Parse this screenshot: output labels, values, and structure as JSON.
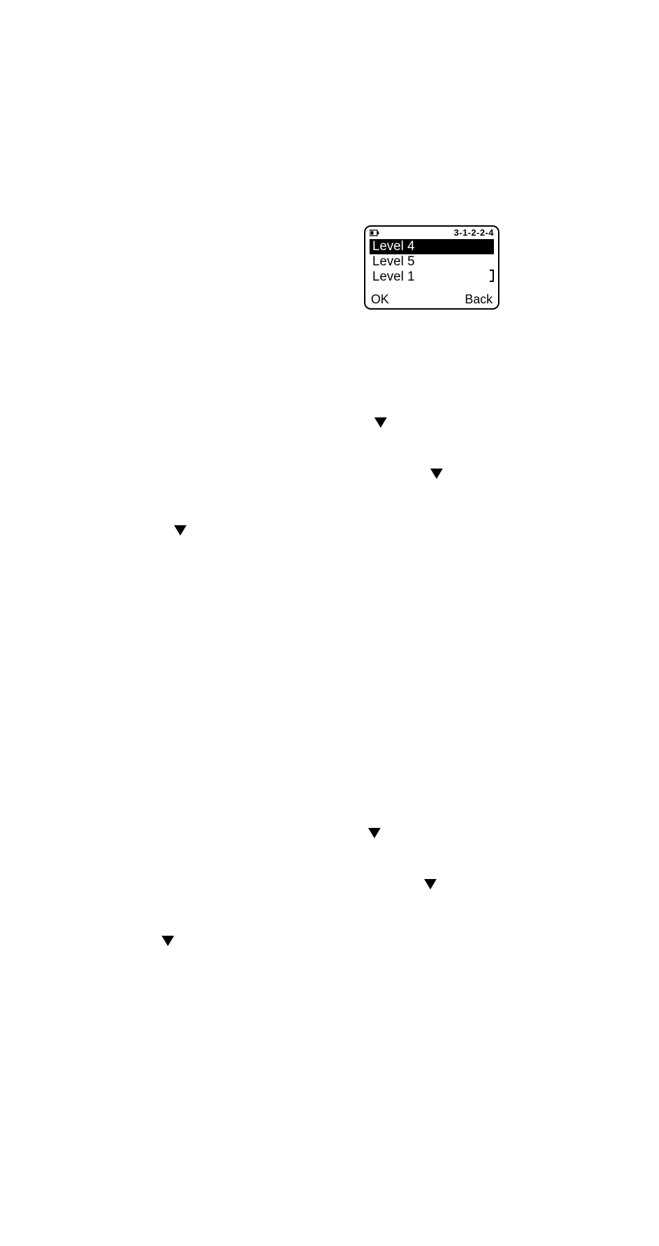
{
  "screen": {
    "menu_code": "3-1-2-2-4",
    "items": [
      "Level 4",
      "Level 5",
      "Level 1"
    ],
    "soft_left": "OK",
    "soft_right": "Back"
  },
  "icons": {
    "battery": "battery-icon",
    "down": "triangle-down-icon"
  }
}
